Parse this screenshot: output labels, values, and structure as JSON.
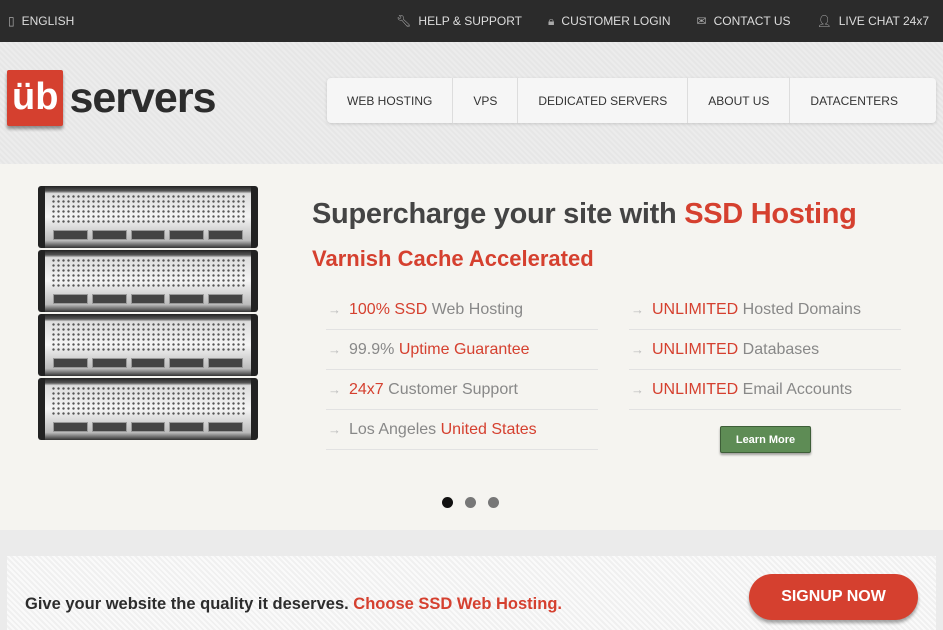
{
  "topbar": {
    "language": "ENGLISH",
    "links": [
      {
        "label": "HELP & SUPPORT",
        "icon": "wrench-icon"
      },
      {
        "label": "CUSTOMER LOGIN",
        "icon": "lock-icon"
      },
      {
        "label": "CONTACT US",
        "icon": "envelope-icon"
      },
      {
        "label": "LIVE CHAT 24x7",
        "icon": "user-icon"
      }
    ]
  },
  "logo": {
    "mark": "üb",
    "text": "servers"
  },
  "nav": [
    "WEB HOSTING",
    "VPS",
    "DEDICATED SERVERS",
    "ABOUT US",
    "DATACENTERS"
  ],
  "hero": {
    "title": "Supercharge your site with ",
    "title_highlight": "SSD Hosting",
    "subtitle": "Varnish Cache Accelerated",
    "left": [
      [
        "",
        "100% SSD",
        " Web Hosting"
      ],
      [
        "99.9% ",
        "Uptime Guarantee",
        ""
      ],
      [
        "",
        "24x7",
        " Customer Support"
      ],
      [
        "Los Angeles ",
        "United States",
        ""
      ]
    ],
    "right": [
      [
        "",
        "UNLIMITED",
        " Hosted Domains"
      ],
      [
        "",
        "UNLIMITED",
        " Databases"
      ],
      [
        "",
        "UNLIMITED",
        " Email Accounts"
      ]
    ],
    "learn_more": "Learn More",
    "slides": 3,
    "active_slide": 1
  },
  "cta": {
    "text": "Give your website the quality it deserves. ",
    "highlight": "Choose SSD Web Hosting.",
    "button": "SIGNUP NOW"
  },
  "colors": {
    "accent": "#d5402f",
    "topbar": "#2b2b2b",
    "button_green": "#5e8c55"
  }
}
